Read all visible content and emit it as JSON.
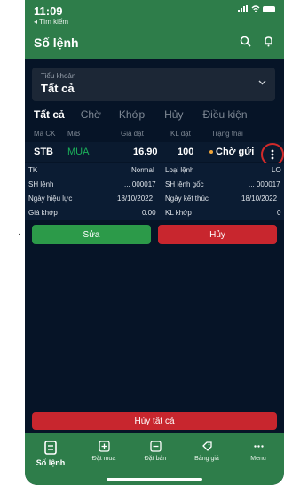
{
  "status": {
    "time": "11:09",
    "back_label": "◂ Tìm kiếm"
  },
  "header": {
    "title": "Số lệnh"
  },
  "account": {
    "label": "Tiểu khoản",
    "value": "Tất cả"
  },
  "tabs": [
    "Tất cả",
    "Chờ",
    "Khớp",
    "Hủy",
    "Điều kiện"
  ],
  "columns": [
    "Mã CK",
    "M/B",
    "Giá đặt",
    "KL đặt",
    "Trạng thái"
  ],
  "order": {
    "symbol": "STB",
    "side": "MUA",
    "price": "16.90",
    "quantity": "100",
    "status": "Chờ gửi"
  },
  "details": {
    "tk_label": "TK",
    "tk_value": "Normal",
    "loai_label": "Loại lệnh",
    "loai_value": "LO",
    "sh_label": "SH lệnh",
    "sh_value": "... 000017",
    "shgoc_label": "SH lệnh gốc",
    "shgoc_value": "... 000017",
    "nhl_label": "Ngày hiệu lực",
    "nhl_value": "18/10/2022",
    "nkt_label": "Ngày kết thúc",
    "nkt_value": "18/10/2022",
    "gk_label": "Giá khớp",
    "gk_value": "0.00",
    "klk_label": "KL khớp",
    "klk_value": "0"
  },
  "actions": {
    "edit": "Sửa",
    "cancel": "Hủy",
    "cancel_all": "Hủy tất cả"
  },
  "nav": [
    "Số lệnh",
    "Đặt mua",
    "Đặt bán",
    "Bảng giá",
    "Menu"
  ],
  "colors": {
    "brand_green": "#2e7d4a",
    "buy_green": "#1bb15a",
    "danger_red": "#c8262e",
    "bg": "#061427"
  },
  "icons": {
    "search": "search-icon",
    "bell": "bell-icon",
    "more": "more-vertical-icon"
  }
}
